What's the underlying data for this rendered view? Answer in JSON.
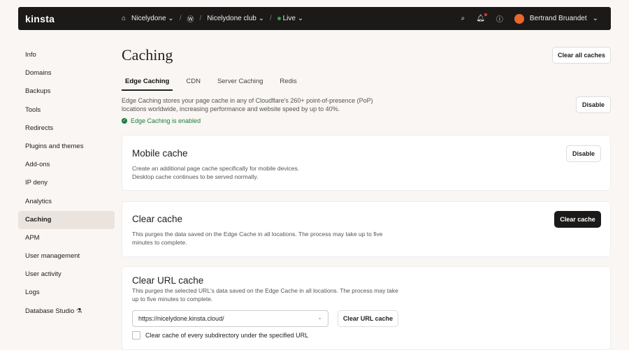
{
  "topbar": {
    "logo": "kinsta",
    "site": "Nicelydone",
    "site_name": "Nicelydone club",
    "environment": "Live",
    "user": "Bertrand Bruandet"
  },
  "sidebar": {
    "items": [
      "Info",
      "Domains",
      "Backups",
      "Tools",
      "Redirects",
      "Plugins and themes",
      "Add-ons",
      "IP deny",
      "Analytics",
      "Caching",
      "APM",
      "User management",
      "User activity",
      "Logs",
      "Database Studio ⚗"
    ],
    "active": "Caching"
  },
  "page": {
    "title": "Caching",
    "clear_all": "Clear all caches"
  },
  "tabs": [
    "Edge Caching",
    "CDN",
    "Server Caching",
    "Redis"
  ],
  "edge": {
    "description": "Edge Caching stores your page cache in any of Cloudflare's 260+ point-of-presence (PoP) locations worldwide, increasing performance and website speed by up to 40%.",
    "disable": "Disable",
    "status": "Edge Caching is enabled"
  },
  "mobile": {
    "title": "Mobile cache",
    "desc1": "Create an additional page cache specifically for mobile devices.",
    "desc2": "Desktop cache continues to be served normally.",
    "button": "Disable"
  },
  "clear": {
    "title": "Clear cache",
    "desc": "This purges the data saved on the Edge Cache in all locations. The process may take up to five minutes to complete.",
    "button": "Clear cache"
  },
  "url": {
    "title": "Clear URL cache",
    "desc": "This purges the selected URL's data saved on the Edge Cache in all locations. The process may take up to five minutes to complete.",
    "value": "https://nicelydone.kinsta.cloud/",
    "button": "Clear URL cache",
    "checkbox": "Clear cache of every subdirectory under the specified URL"
  }
}
